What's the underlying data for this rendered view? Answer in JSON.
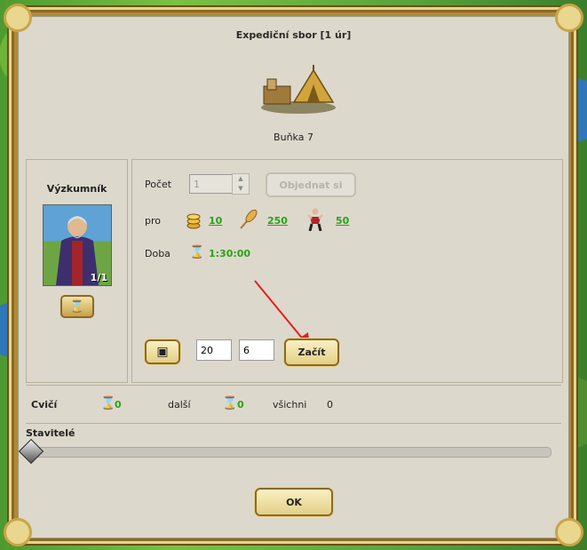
{
  "dialog": {
    "title": "Expediční sbor [1 úr]",
    "cell": "Buňka 7",
    "building_icon": "tent-camp-icon"
  },
  "unit": {
    "name": "Výzkumník",
    "count": "1/1",
    "portrait_icon": "researcher-portrait"
  },
  "order": {
    "count_label": "Počet",
    "count_value": "1",
    "order_button": "Objednat si",
    "for_label": "pro",
    "costs": [
      {
        "icon": "gold-coins-icon",
        "value": "10"
      },
      {
        "icon": "wheat-icon",
        "value": "250"
      },
      {
        "icon": "settler-icon",
        "value": "50"
      }
    ],
    "duration_label": "Doba",
    "duration_value": "1:30:00"
  },
  "training": {
    "field1": "20",
    "field2": "6",
    "start_button": "Začít"
  },
  "status": {
    "training_label": "Cvičí",
    "training_value": "0",
    "next_label": "další",
    "next_value": "0",
    "all_label": "všichni",
    "all_value": "0"
  },
  "builders": {
    "label": "Stavitelé"
  },
  "ok_button": "OK",
  "colors": {
    "accent_green": "#2aa217",
    "arrow_red": "#e02020"
  }
}
